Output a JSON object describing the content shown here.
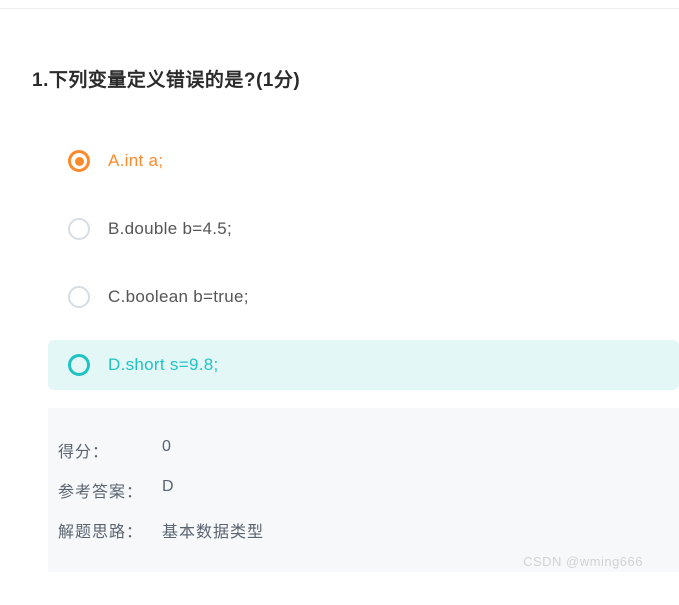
{
  "question": {
    "number": "1",
    "text": "下列变量定义错误的是?",
    "points_text": "1分"
  },
  "options": [
    {
      "key": "A",
      "text": "A.int a;",
      "selected": true,
      "highlighted": false
    },
    {
      "key": "B",
      "text": "B.double b=4.5;",
      "selected": false,
      "highlighted": false
    },
    {
      "key": "C",
      "text": "C.boolean b=true;",
      "selected": false,
      "highlighted": false
    },
    {
      "key": "D",
      "text": "D.short s=9.8;",
      "selected": false,
      "highlighted": true
    }
  ],
  "answer": {
    "score_label": "得分：",
    "score_value": "0",
    "reference_label": "参考答案：",
    "reference_value": "D",
    "explain_label": "解题思路：",
    "explain_value": "基本数据类型"
  },
  "watermark": "CSDN @wming666"
}
